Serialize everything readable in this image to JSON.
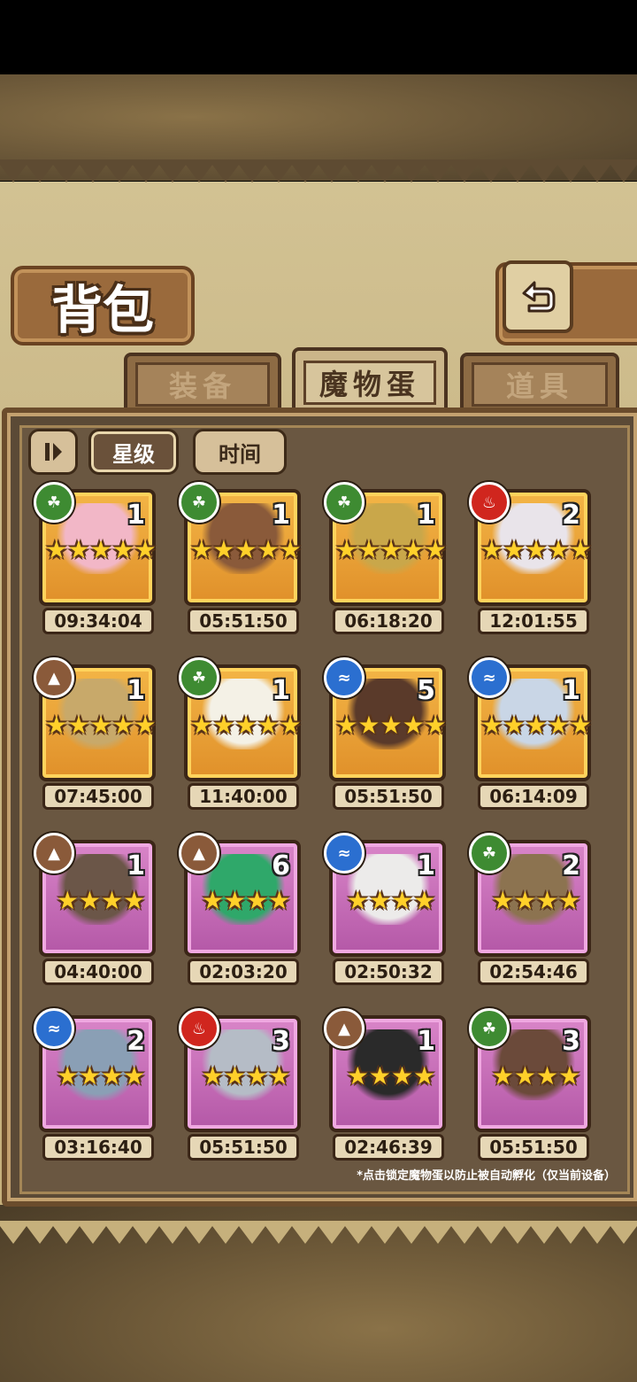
{
  "header": {
    "title": "背包"
  },
  "tabs": [
    {
      "label": "装备",
      "active": false
    },
    {
      "label": "魔物蛋",
      "active": true
    },
    {
      "label": "道具",
      "active": false
    }
  ],
  "toolbar": {
    "sort_star_label": "星级",
    "sort_time_label": "时间"
  },
  "eggs": [
    {
      "element": "nature",
      "count": "1",
      "stars": 5,
      "frame": "gold",
      "timer": "09:34:04",
      "art_color": "#f2b7c7"
    },
    {
      "element": "nature",
      "count": "1",
      "stars": 5,
      "frame": "gold",
      "timer": "05:51:50",
      "art_color": "#8a5a3a"
    },
    {
      "element": "nature",
      "count": "1",
      "stars": 5,
      "frame": "gold",
      "timer": "06:18:20",
      "art_color": "#c9a74a"
    },
    {
      "element": "fire",
      "count": "2",
      "stars": 5,
      "frame": "gold",
      "timer": "12:01:55",
      "art_color": "#e9e4ea"
    },
    {
      "element": "earth",
      "count": "1",
      "stars": 5,
      "frame": "gold",
      "timer": "07:45:00",
      "art_color": "#c8a96a"
    },
    {
      "element": "nature",
      "count": "1",
      "stars": 5,
      "frame": "gold",
      "timer": "11:40:00",
      "art_color": "#f4f1e6"
    },
    {
      "element": "water",
      "count": "5",
      "stars": 5,
      "frame": "gold",
      "timer": "05:51:50",
      "art_color": "#5a3a2a"
    },
    {
      "element": "water",
      "count": "1",
      "stars": 5,
      "frame": "gold",
      "timer": "06:14:09",
      "art_color": "#c9d6e6"
    },
    {
      "element": "earth",
      "count": "1",
      "stars": 4,
      "frame": "purple",
      "timer": "04:40:00",
      "art_color": "#6b5648"
    },
    {
      "element": "earth",
      "count": "6",
      "stars": 4,
      "frame": "purple",
      "timer": "02:03:20",
      "art_color": "#2fa86a"
    },
    {
      "element": "water",
      "count": "1",
      "stars": 4,
      "frame": "purple",
      "timer": "02:50:32",
      "art_color": "#ecebea"
    },
    {
      "element": "nature",
      "count": "2",
      "stars": 4,
      "frame": "purple",
      "timer": "02:54:46",
      "art_color": "#8c7350"
    },
    {
      "element": "water",
      "count": "2",
      "stars": 4,
      "frame": "purple",
      "timer": "03:16:40",
      "art_color": "#8a9fb5"
    },
    {
      "element": "fire",
      "count": "3",
      "stars": 4,
      "frame": "purple",
      "timer": "05:51:50",
      "art_color": "#b5bcc6"
    },
    {
      "element": "earth",
      "count": "1",
      "stars": 4,
      "frame": "purple",
      "timer": "02:46:39",
      "art_color": "#2a2a2a"
    },
    {
      "element": "nature",
      "count": "3",
      "stars": 4,
      "frame": "purple",
      "timer": "05:51:50",
      "art_color": "#6b4a3a"
    }
  ],
  "footer": {
    "note": "*点击锁定魔物蛋以防止被自动孵化（仅当前设备）"
  }
}
